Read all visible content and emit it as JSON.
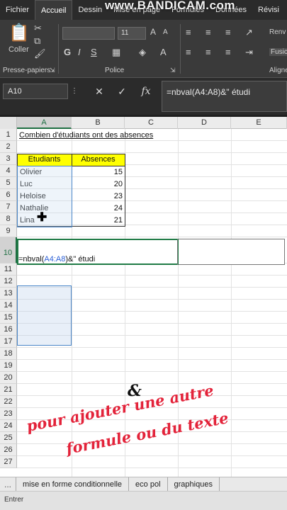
{
  "ribbon_tabs": [
    {
      "label": "Fichier",
      "active": false
    },
    {
      "label": "Accueil",
      "active": true
    },
    {
      "label": "Dessin",
      "active": false
    },
    {
      "label": "Mise en page",
      "active": false
    },
    {
      "label": "Formules",
      "active": false
    },
    {
      "label": "Données",
      "active": false
    },
    {
      "label": "Révisi",
      "active": false
    }
  ],
  "watermark": "www.BANDICAM.com",
  "ribbon": {
    "paste_label": "Coller",
    "clipboard_group": "Presse-papiers",
    "font_group": "Police",
    "align_group": "Aligne",
    "bold": "G",
    "italic": "I",
    "underline": "S",
    "font_size": "11",
    "wrap_label": "Renv",
    "merge_label": "Fusic"
  },
  "formula_bar": {
    "name_box": "A10",
    "cancel": "✕",
    "confirm": "✓",
    "fx": "fx",
    "formula": "=nbval(A4:A8)&\" étudi"
  },
  "columns": [
    "A",
    "B",
    "C",
    "D",
    "E"
  ],
  "rows": [
    "1",
    "2",
    "3",
    "4",
    "5",
    "6",
    "7",
    "8",
    "9",
    "10",
    "11",
    "12",
    "13",
    "14",
    "15",
    "16",
    "17",
    "18",
    "19",
    "20",
    "21",
    "22",
    "23",
    "24",
    "25",
    "26",
    "27"
  ],
  "sheet": {
    "title": "Combien d'étudiants ont des absences",
    "headers": {
      "students": "Etudiants",
      "absences": "Absences"
    },
    "data": [
      {
        "name": "Olivier",
        "absences": "15"
      },
      {
        "name": "Luc",
        "absences": "20"
      },
      {
        "name": "Heloise",
        "absences": "23"
      },
      {
        "name": "Nathalie",
        "absences": "24"
      },
      {
        "name": "Lina",
        "absences": "21"
      }
    ],
    "edit_prefix": "=nbval(",
    "edit_ref": "A4:A8",
    "edit_suffix": ")&\" étudi"
  },
  "overlay": {
    "amp": "&",
    "line1": "pour ajouter une autre",
    "line2": "formule ou du texte",
    "color": "#e3233a"
  },
  "sheet_tabs": [
    "...",
    "mise en forme conditionnelle",
    "eco pol",
    "graphiques"
  ],
  "status_mode": "Entrer"
}
